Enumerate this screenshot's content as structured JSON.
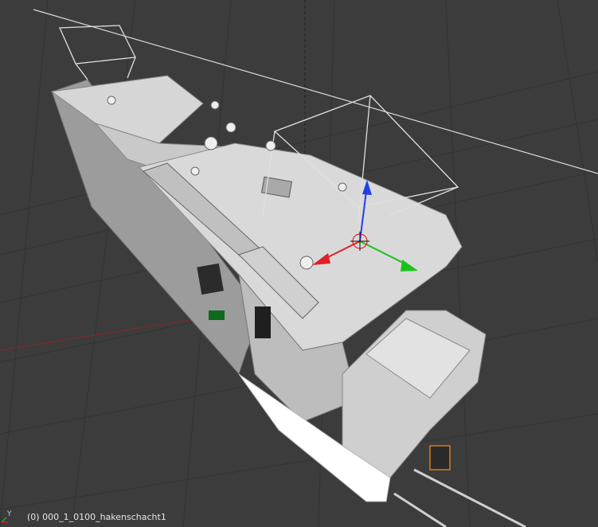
{
  "viewport": {
    "status_text": "(0) 000_1_0100_hakenschacht1",
    "axis_label_y": "Y"
  },
  "colors": {
    "background": "#3c3c3c",
    "grid": "#2f2f2f",
    "x_axis": "#8a2a2a",
    "model_light": "#d9d9d9",
    "model_mid": "#b5b5b5",
    "model_dark": "#7d7d7d",
    "gizmo_x": "#e0202a",
    "gizmo_y": "#1ec01e",
    "gizmo_z": "#2040e8",
    "selection": "#ff8c1a"
  },
  "icons": {
    "transform_gizmo": "move-gizmo-icon",
    "view_axis": "axis-icon"
  }
}
